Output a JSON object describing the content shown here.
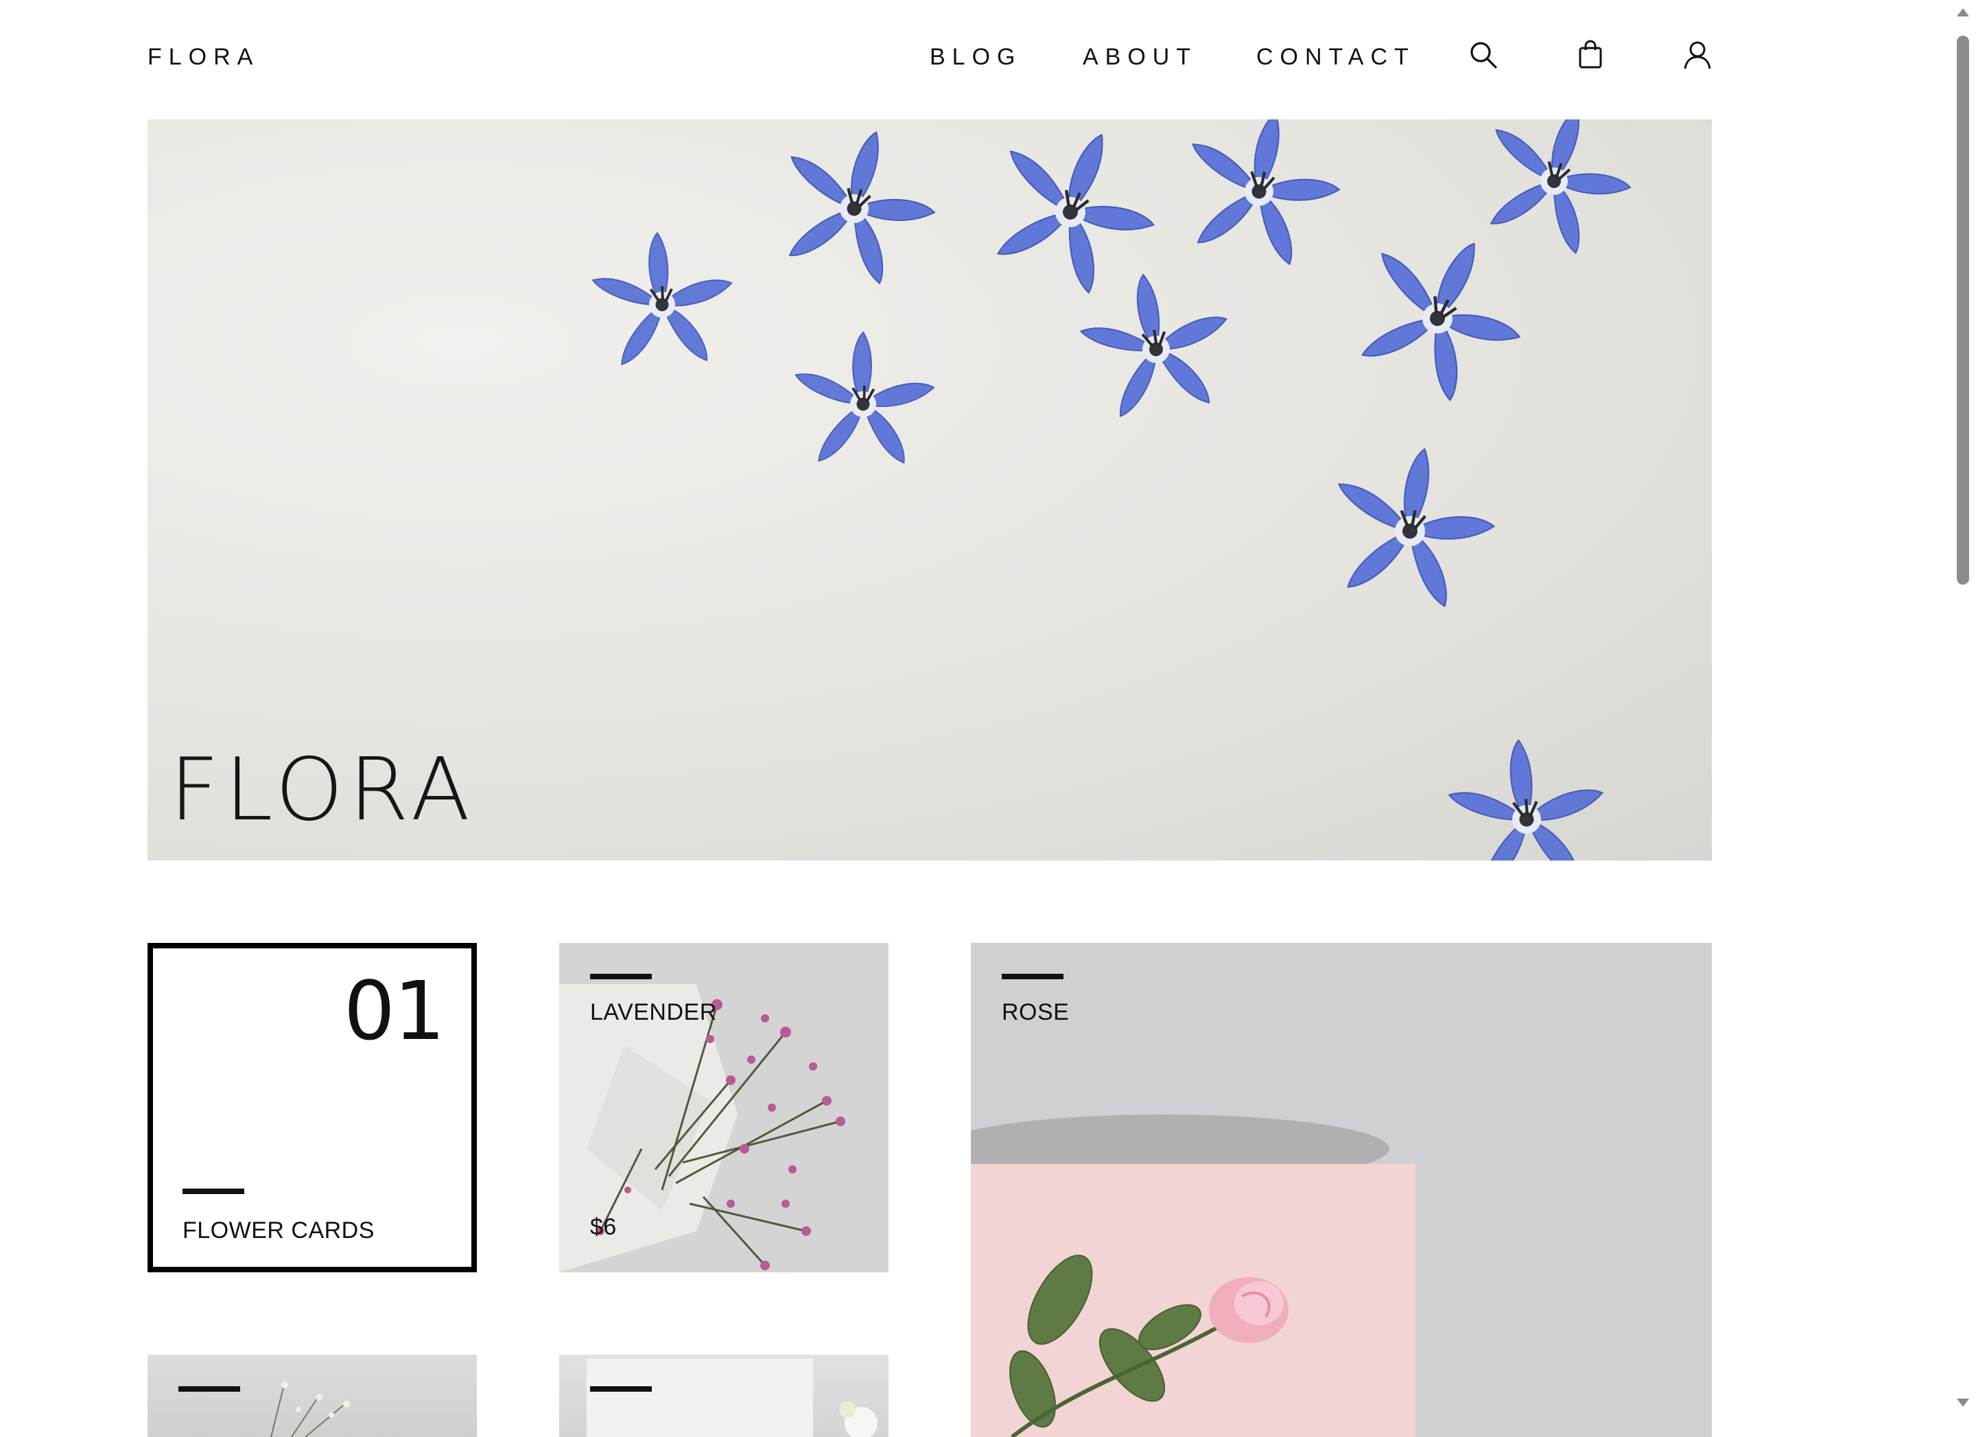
{
  "header": {
    "logo": "FLORA",
    "nav": [
      {
        "label": "BLOG"
      },
      {
        "label": "ABOUT"
      },
      {
        "label": "CONTACT"
      }
    ],
    "icons": [
      "search-icon",
      "shopping-bag-icon",
      "user-icon"
    ]
  },
  "hero": {
    "title": "FLORA"
  },
  "tiles": {
    "category": {
      "number": "01",
      "label": "FLOWER CARDS"
    },
    "lavender": {
      "label": "LAVENDER",
      "price": "$6"
    },
    "rose": {
      "label": "ROSE"
    }
  },
  "colors": {
    "text": "#111111",
    "background": "#ffffff",
    "flower_blue": "#5a72d6",
    "paper_pink": "#f3d4d4"
  }
}
